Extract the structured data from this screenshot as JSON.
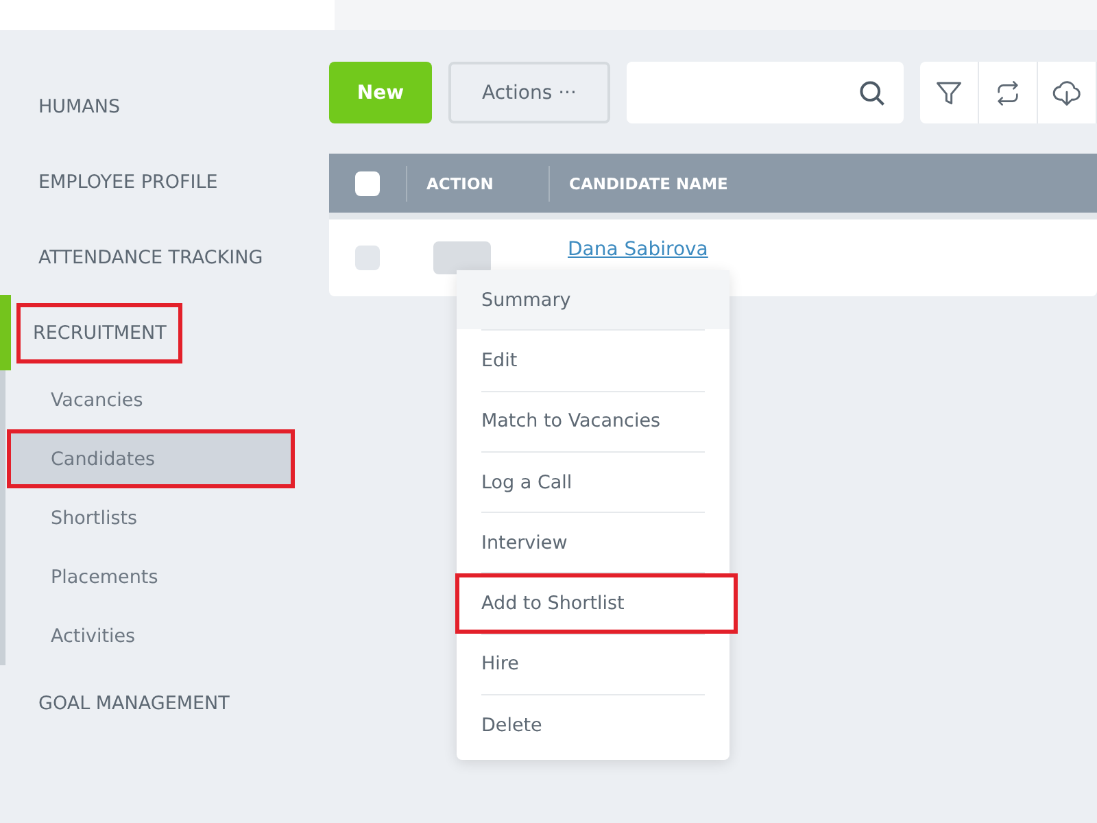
{
  "sidebar": {
    "items": [
      {
        "label": "HUMANS",
        "highlighted": false
      },
      {
        "label": "EMPLOYEE PROFILE",
        "highlighted": false
      },
      {
        "label": "ATTENDANCE TRACKING",
        "highlighted": false
      },
      {
        "label": "RECRUITMENT",
        "highlighted": true,
        "children": [
          {
            "label": "Vacancies",
            "selected": false,
            "highlighted": false
          },
          {
            "label": "Candidates",
            "selected": true,
            "highlighted": true
          },
          {
            "label": "Shortlists",
            "selected": false,
            "highlighted": false
          },
          {
            "label": "Placements",
            "selected": false,
            "highlighted": false
          },
          {
            "label": "Activities",
            "selected": false,
            "highlighted": false
          }
        ]
      },
      {
        "label": "GOAL MANAGEMENT",
        "highlighted": false
      }
    ]
  },
  "toolbar": {
    "new_button": "New",
    "actions_button": "Actions ···"
  },
  "table": {
    "columns": [
      "ACTION",
      "CANDIDATE NAME"
    ],
    "header_checked": false,
    "rows": [
      {
        "checked": false,
        "name": "Dana Sabirova"
      }
    ]
  },
  "context_menu": {
    "items": [
      {
        "label": "Summary",
        "hovered": true,
        "highlighted": false
      },
      {
        "label": "Edit",
        "hovered": false,
        "highlighted": false
      },
      {
        "label": "Match to Vacancies",
        "hovered": false,
        "highlighted": false
      },
      {
        "label": "Log a Call",
        "hovered": false,
        "highlighted": false
      },
      {
        "label": "Interview",
        "hovered": false,
        "highlighted": false
      },
      {
        "label": "Add to Shortlist",
        "hovered": false,
        "highlighted": true
      },
      {
        "label": "Hire",
        "hovered": false,
        "highlighted": false
      },
      {
        "label": "Delete",
        "hovered": false,
        "highlighted": false
      }
    ]
  }
}
